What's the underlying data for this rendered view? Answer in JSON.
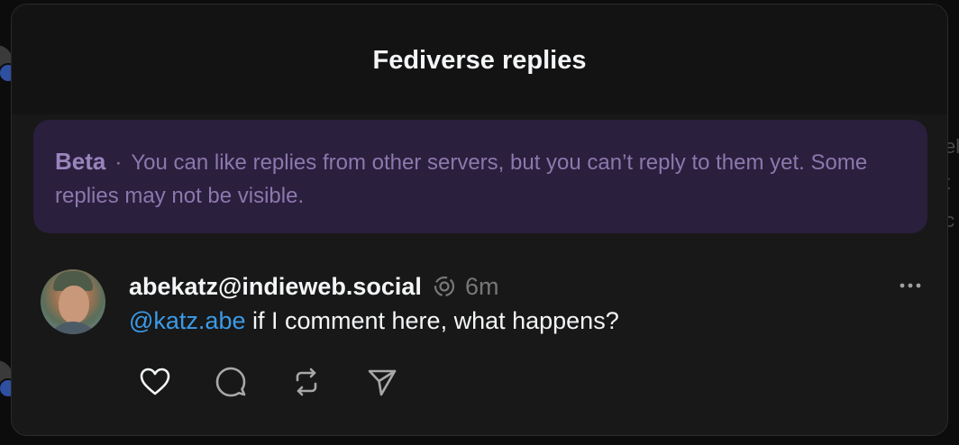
{
  "modal": {
    "title": "Fediverse replies"
  },
  "banner": {
    "label": "Beta",
    "separator": "·",
    "message": "You can like replies from other servers, but you can’t reply to them yet. Some replies may not be visible."
  },
  "reply": {
    "username": "abekatz@indieweb.social",
    "fediverse_icon": "fediverse-icon",
    "timestamp": "6m",
    "mention": "@katz.abe",
    "text": " if I comment here, what happens?",
    "more_icon": "more-horizontal-icon",
    "actions": [
      {
        "icon": "heart-icon"
      },
      {
        "icon": "comment-icon"
      },
      {
        "icon": "repost-icon"
      },
      {
        "icon": "share-icon"
      }
    ]
  },
  "background": {
    "right_fragments": [
      "el",
      "t",
      "c"
    ]
  },
  "colors": {
    "modal_bg": "#181818",
    "banner_bg": "#2a1f3d",
    "banner_text": "#8c78ad",
    "mention": "#3b9ae8",
    "muted": "#777777"
  }
}
